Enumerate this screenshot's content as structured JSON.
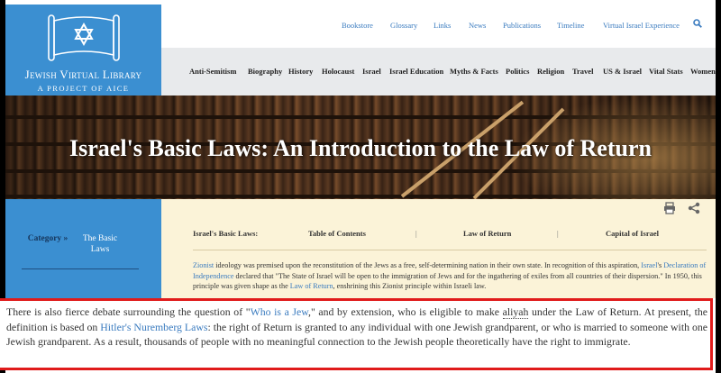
{
  "logo": {
    "name": "Jewish Virtual Library",
    "subtitle": "A PROJECT OF AICE"
  },
  "top_nav": [
    "Bookstore",
    "Glossary",
    "Links",
    "News",
    "Publications",
    "Timeline",
    "Virtual Israel Experience"
  ],
  "main_nav": [
    "Anti-Semitism",
    "Biography",
    "History",
    "Holocaust",
    "Israel",
    "Israel Education",
    "Myths & Facts",
    "Politics",
    "Religion",
    "Travel",
    "US & Israel",
    "Vital Stats",
    "Women"
  ],
  "hero": {
    "title": "Israel's Basic Laws: An Introduction to the Law of Return"
  },
  "sidebar": {
    "category_label": "Category »",
    "category_value": "The Basic Laws"
  },
  "tabs": {
    "prefix": "Israel's Basic Laws:",
    "items": [
      "Table of Contents",
      "Law of Return",
      "Capital of Israel"
    ],
    "separator": "|"
  },
  "intro": {
    "p1_link1": "Zionist",
    "p1_t1": " ideology was premised upon the reconstitution of the Jews as a free, self-determining nation in their own state. In recognition of this aspiration, ",
    "p1_link2": "Israel",
    "p1_t2": "'s ",
    "p1_link3": "Declaration of Independence",
    "p1_t3": " declared that \"The State of Israel will be open to the immigration of Jews and for the ingathering of exiles from all countries of their dispersion.\" In 1950, this principle was given shape as the ",
    "p1_link4": "Law of Return",
    "p1_t4": ", enshrining this Zionist principle within Israeli law."
  },
  "highlight": {
    "t1": "There is also fierce debate surrounding the question of \"",
    "link1": "Who is a Jew",
    "t2": ",\" and by extension, who is eligible to make ",
    "term": "aliyah",
    "t3": " under the Law of Return. At present, the definition is based on ",
    "link2": "Hitler's Nuremberg Laws",
    "t4": ": the right of Return is granted to any individual with one Jewish grandparent, or who is married to someone with one Jewish grandparent. As a result, thousands of people with no meaningful connection to the Jewish people theoretically have the right to immigrate."
  },
  "icons": {
    "search": "search-icon",
    "print": "print-icon",
    "share": "share-icon",
    "logo": "torah-scroll-star-of-david-icon"
  },
  "colors": {
    "brand_blue": "#3b8fd1",
    "link_blue": "#3a7bbf",
    "content_bg": "#fbf3d8",
    "highlight_border": "#e01b1b"
  }
}
